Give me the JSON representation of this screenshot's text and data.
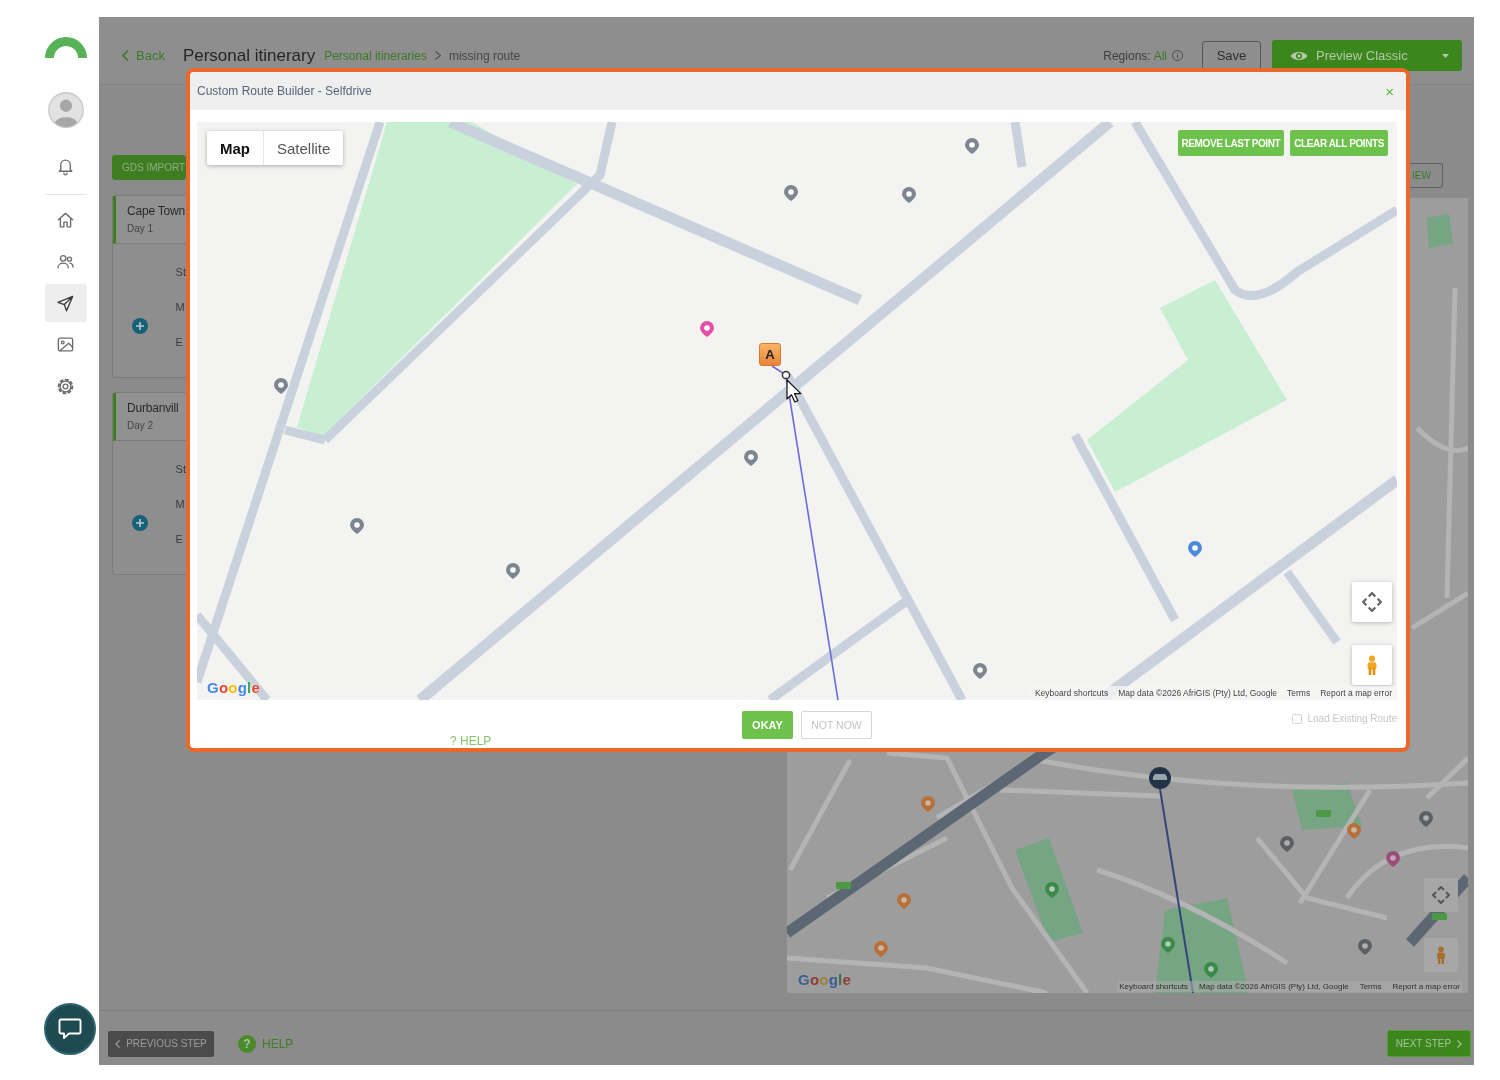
{
  "sidebar": {
    "nav": [
      {
        "selected": false
      },
      {
        "selected": false
      },
      {
        "selected": true
      },
      {
        "selected": false
      },
      {
        "selected": false
      }
    ]
  },
  "header": {
    "back": "Back",
    "title": "Personal itinerary",
    "breadcrumb": [
      "Personal itineraries",
      "missing route"
    ],
    "regions_label": "Regions:",
    "regions_value": "All",
    "save": "Save",
    "preview": "Preview Classic"
  },
  "itinerary": {
    "import_button": "GDS IMPORT",
    "days": [
      {
        "place": "Cape Town",
        "day": "Day 1",
        "lines": [
          "St",
          "M",
          "E"
        ]
      },
      {
        "place": "Durbanvill",
        "day": "Day 2",
        "lines": [
          "St",
          "M",
          "E"
        ]
      }
    ]
  },
  "route_map": {
    "view_button": "IEW",
    "logo": "Google",
    "attribution": [
      "Keyboard shortcuts",
      "Map data ©2026 AfriGIS (Pty) Ltd, Google",
      "Terms",
      "Report a map error"
    ]
  },
  "footer": {
    "previous": "PREVIOUS STEP",
    "help_icon": "?",
    "help": "HELP",
    "next": "NEXT STEP"
  },
  "modal": {
    "title": "Custom Route Builder - Selfdrive",
    "close": "×",
    "map_types": [
      {
        "label": "Map",
        "selected": true
      },
      {
        "label": "Satellite",
        "selected": false
      }
    ],
    "actions": [
      "REMOVE LAST POINT",
      "CLEAR ALL POINTS"
    ],
    "marker": "A",
    "logo": "Google",
    "attribution": [
      "Keyboard shortcuts",
      "Map data ©2026 AfriGIS (Pty) Ltd, Google",
      "Terms",
      "Report a map error"
    ],
    "okay": "OKAY",
    "not_now": "NOT NOW",
    "help": "? HELP",
    "load_existing": {
      "label": "Load Existing Route",
      "checked": false,
      "disabled": true
    }
  }
}
